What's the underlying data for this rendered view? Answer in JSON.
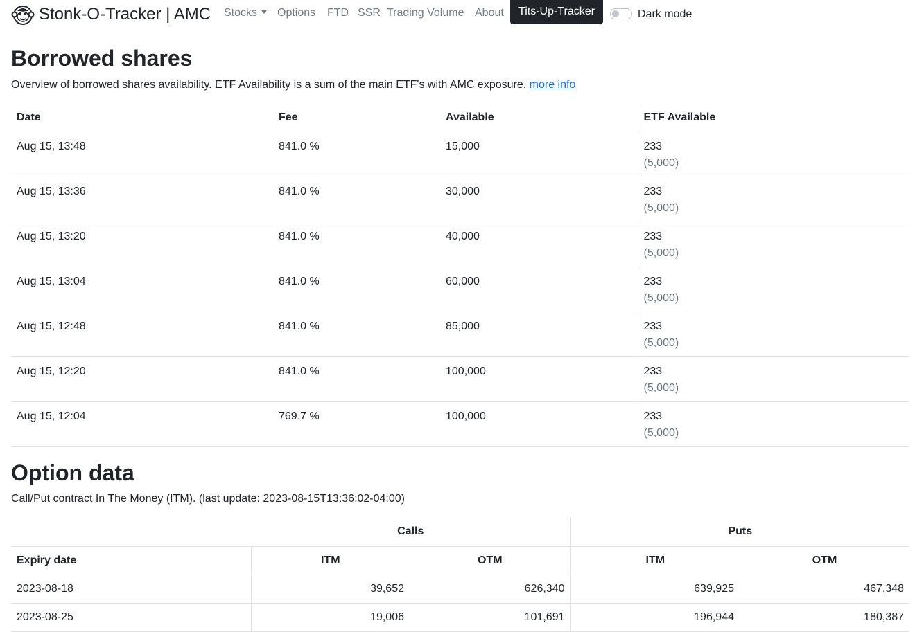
{
  "navbar": {
    "brand": "Stonk-O-Tracker | AMC",
    "items": [
      {
        "label": "Stocks",
        "dropdown": true
      },
      {
        "label": "Options"
      },
      {
        "label": "FTD"
      },
      {
        "label": "SSR"
      },
      {
        "label": "Trading Volume"
      },
      {
        "label": "About"
      }
    ],
    "highlight_button": "Tits-Up-Tracker",
    "dark_mode_label": "Dark mode",
    "dark_mode_on": false
  },
  "borrowed": {
    "title": "Borrowed shares",
    "description": "Overview of borrowed shares availability. ETF Availability is a sum of the main ETF's with AMC exposure.",
    "more_info": "more info",
    "headers": [
      "Date",
      "Fee",
      "Available",
      "ETF Available"
    ],
    "rows": [
      {
        "date": "Aug 15, 13:48",
        "fee": "841.0 %",
        "available": "15,000",
        "etf": "233",
        "etf_sub": "(5,000)"
      },
      {
        "date": "Aug 15, 13:36",
        "fee": "841.0 %",
        "available": "30,000",
        "etf": "233",
        "etf_sub": "(5,000)"
      },
      {
        "date": "Aug 15, 13:20",
        "fee": "841.0 %",
        "available": "40,000",
        "etf": "233",
        "etf_sub": "(5,000)"
      },
      {
        "date": "Aug 15, 13:04",
        "fee": "841.0 %",
        "available": "60,000",
        "etf": "233",
        "etf_sub": "(5,000)"
      },
      {
        "date": "Aug 15, 12:48",
        "fee": "841.0 %",
        "available": "85,000",
        "etf": "233",
        "etf_sub": "(5,000)"
      },
      {
        "date": "Aug 15, 12:20",
        "fee": "841.0 %",
        "available": "100,000",
        "etf": "233",
        "etf_sub": "(5,000)"
      },
      {
        "date": "Aug 15, 12:04",
        "fee": "769.7 %",
        "available": "100,000",
        "etf": "233",
        "etf_sub": "(5,000)"
      }
    ]
  },
  "options": {
    "title": "Option data",
    "description": "Call/Put contract In The Money (ITM). (last update: 2023-08-15T13:36:02-04:00)",
    "group_headers": {
      "calls": "Calls",
      "puts": "Puts"
    },
    "headers": [
      "Expiry date",
      "ITM",
      "OTM",
      "ITM",
      "OTM"
    ],
    "rows": [
      {
        "expiry": "2023-08-18",
        "calls_itm": "39,652",
        "calls_otm": "626,340",
        "puts_itm": "639,925",
        "puts_otm": "467,348"
      },
      {
        "expiry": "2023-08-25",
        "calls_itm": "19,006",
        "calls_otm": "101,691",
        "puts_itm": "196,944",
        "puts_otm": "180,387"
      }
    ]
  }
}
